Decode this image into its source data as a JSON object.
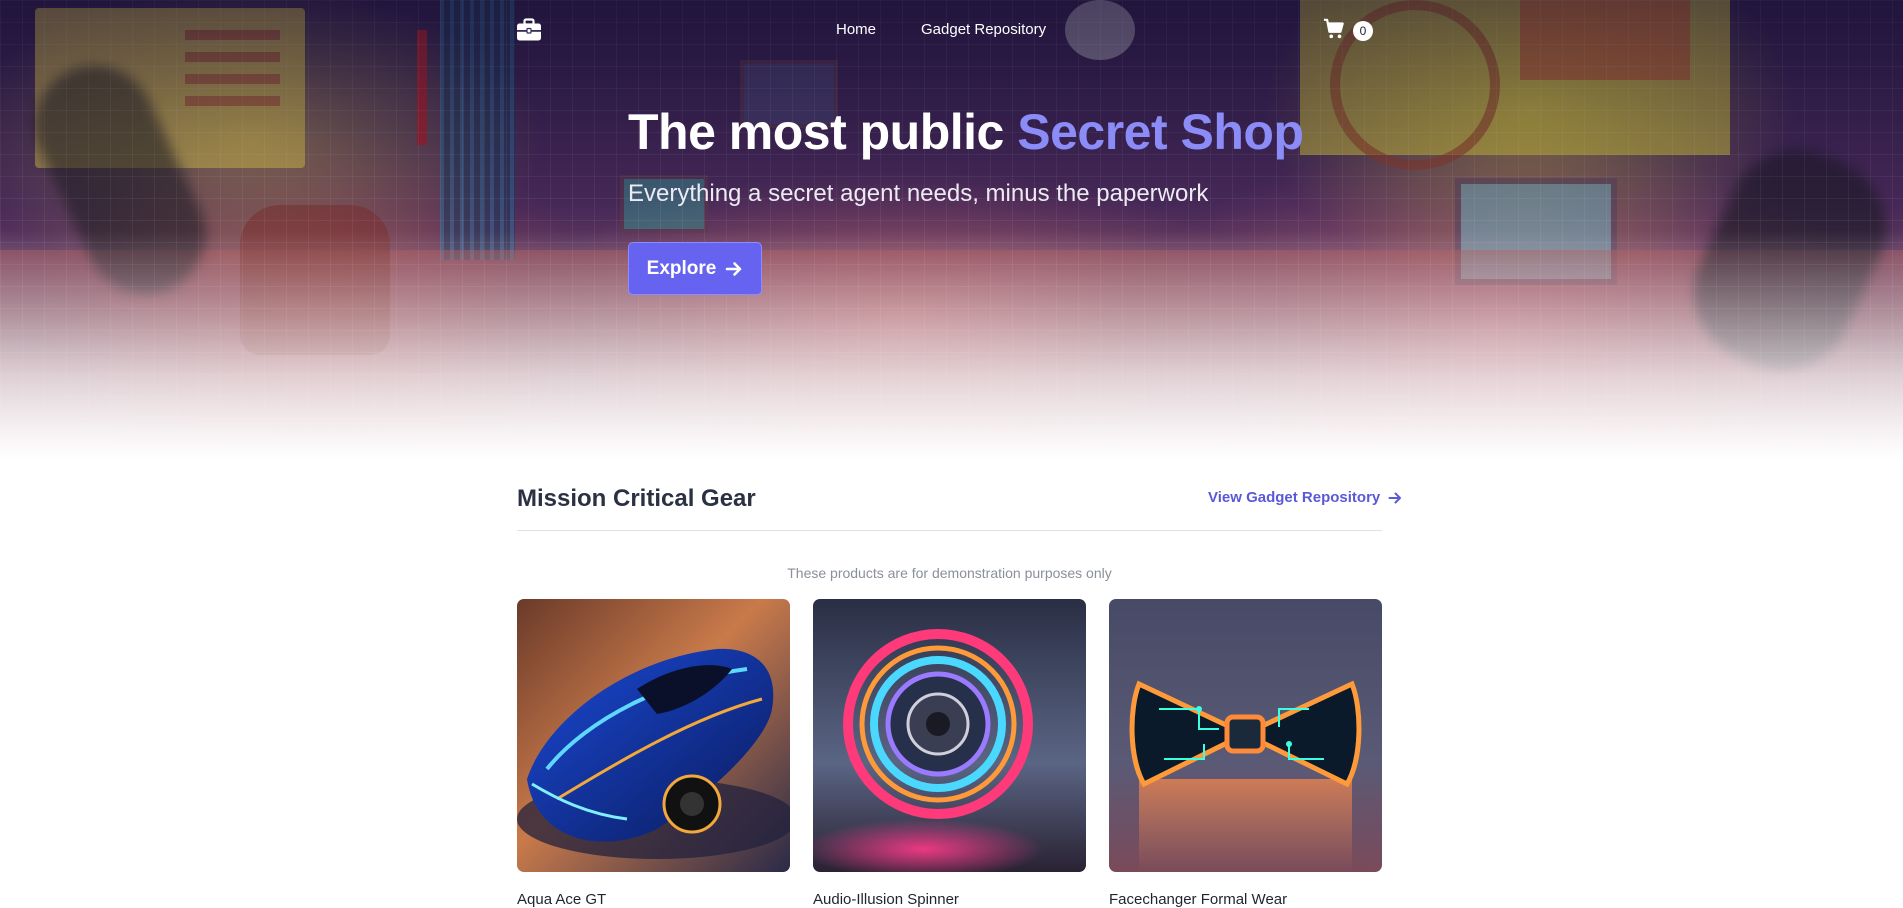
{
  "nav": {
    "brand_icon": "briefcase-icon",
    "links": [
      {
        "label": "Home"
      },
      {
        "label": "Gadget Repository"
      }
    ],
    "cart_icon": "cart-icon",
    "cart_count": "0"
  },
  "hero": {
    "title_main": "The most public ",
    "title_accent": "Secret Shop",
    "subtitle": "Everything a secret agent needs, minus the paperwork",
    "cta_label": "Explore",
    "accent_color": "#8b8cf7",
    "button_color": "#6563f0"
  },
  "section": {
    "title": "Mission Critical Gear",
    "link_label": "View Gadget Repository",
    "note": "These products are for demonstration purposes only"
  },
  "products": [
    {
      "name": "Aqua Ace GT",
      "image": "blue-neon-sports-car"
    },
    {
      "name": "Audio-Illusion Spinner",
      "image": "neon-ring-spinner"
    },
    {
      "name": "Facechanger Formal Wear",
      "image": "circuit-bow-tie"
    }
  ]
}
